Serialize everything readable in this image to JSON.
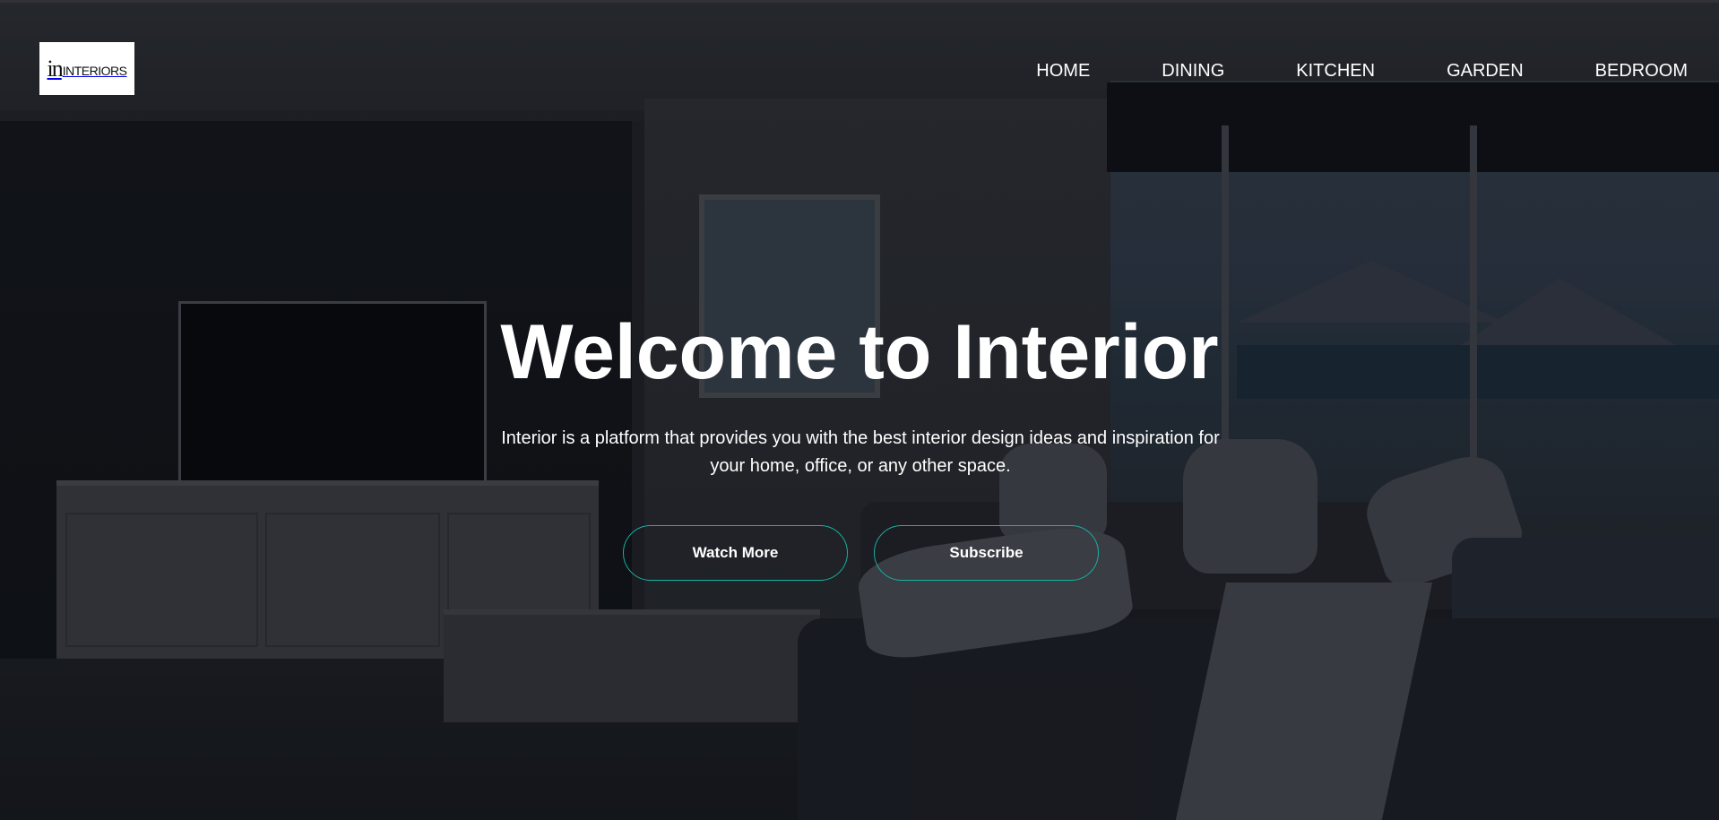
{
  "header": {
    "logo": {
      "mark": "in",
      "text": "INTERIORS"
    },
    "nav": [
      {
        "label": "HOME"
      },
      {
        "label": "DINING"
      },
      {
        "label": "KITCHEN"
      },
      {
        "label": "GARDEN"
      },
      {
        "label": "BEDROOM"
      }
    ]
  },
  "hero": {
    "title": "Welcome to Interior",
    "subtitle": "Interior is a platform that provides you with the best interior design ideas and inspiration for your home, office, or any other space.",
    "buttons": {
      "watch_more": "Watch More",
      "subscribe": "Subscribe"
    },
    "accent_color": "#17b3a3",
    "background_image": "dark living room interior with TV cabinet, sofa and sea-view window"
  }
}
